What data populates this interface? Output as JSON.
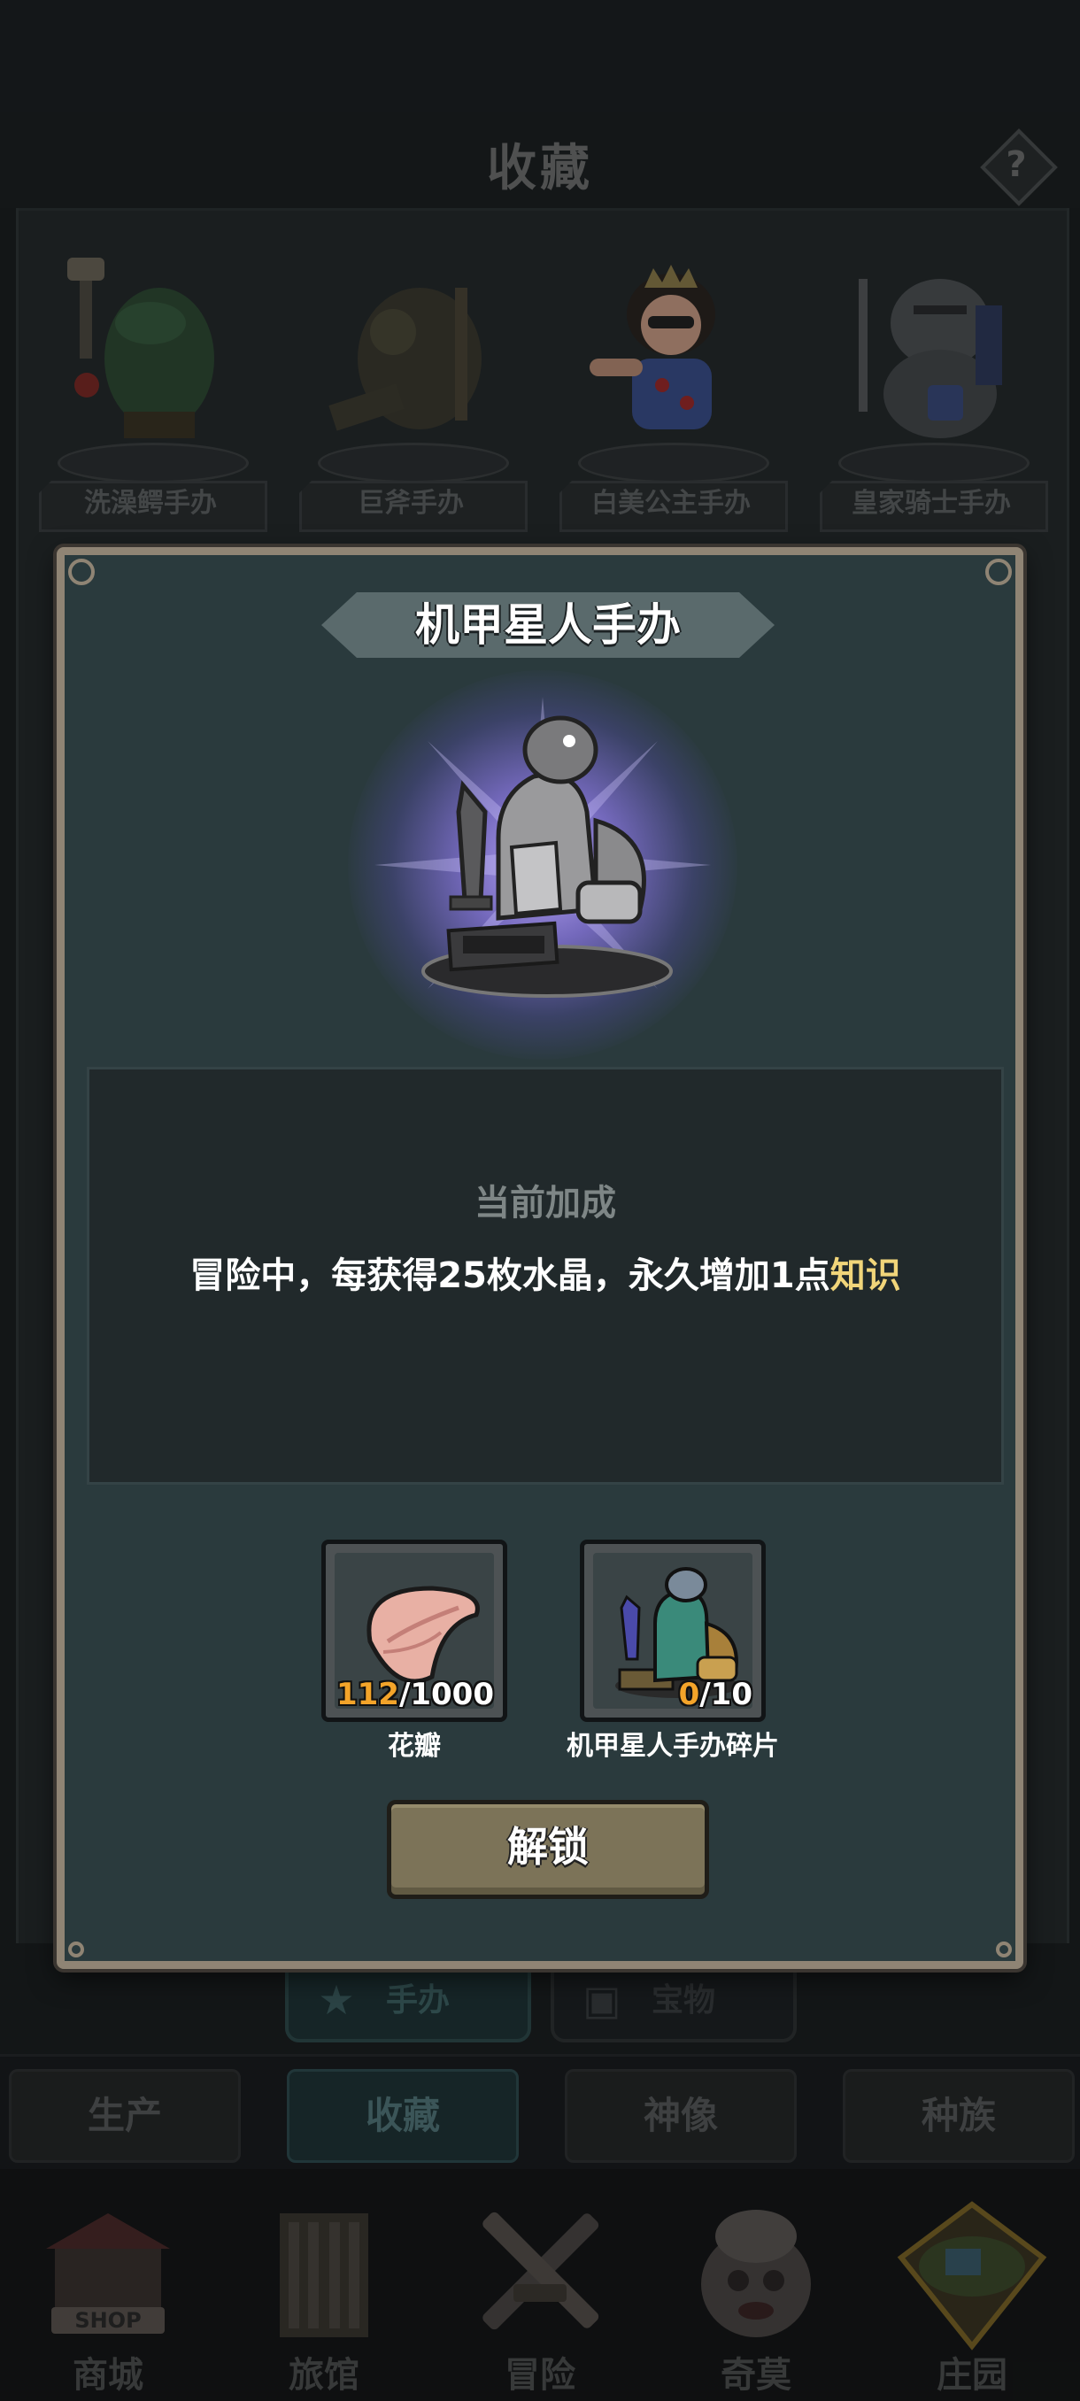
{
  "header": {
    "title": "收藏",
    "help_label": "?"
  },
  "collection": {
    "cards": [
      {
        "label": "洗澡鳄手办",
        "icon": "crocodile-figure-icon"
      },
      {
        "label": "巨斧手办",
        "icon": "skeleton-figure-icon"
      },
      {
        "label": "白美公主手办",
        "icon": "princess-figure-icon"
      },
      {
        "label": "皇家骑士手办",
        "icon": "knight-figure-icon"
      }
    ]
  },
  "subtabs": [
    {
      "label": "手办",
      "icon": "star-icon",
      "active": true
    },
    {
      "label": "宝物",
      "icon": "chest-icon",
      "active": false
    }
  ],
  "main_tabs": [
    {
      "label": "生产",
      "active": false
    },
    {
      "label": "收藏",
      "active": true
    },
    {
      "label": "神像",
      "active": false
    },
    {
      "label": "种族",
      "active": false
    }
  ],
  "bottom_nav": [
    {
      "label": "商城",
      "icon": "shop-icon",
      "icon_text": "SHOP"
    },
    {
      "label": "旅馆",
      "icon": "tavern-icon"
    },
    {
      "label": "冒险",
      "icon": "crossed-swords-icon"
    },
    {
      "label": "奇莫",
      "icon": "mascot-icon"
    },
    {
      "label": "庄园",
      "icon": "island-icon"
    }
  ],
  "dialog": {
    "title": "机甲星人手办",
    "figure_icon": "mech-alien-figure-icon",
    "bonus_title": "当前加成",
    "bonus_text": "冒险中，每获得25枚水晶，永久增加1点",
    "bonus_highlight": "知识",
    "materials": [
      {
        "name": "花瓣",
        "have": "112",
        "need": "/1000",
        "icon": "petal-icon"
      },
      {
        "name": "机甲星人手办碎片",
        "have": "0",
        "need": "/10",
        "icon": "mech-alien-fragment-icon"
      }
    ],
    "unlock_label": "解锁"
  },
  "colors": {
    "dialog_border": "#8f8474",
    "dialog_bg": "#2a3a3d",
    "highlight": "#f1d57a",
    "count_have": "#f3a42a",
    "button": "#7c7358"
  }
}
